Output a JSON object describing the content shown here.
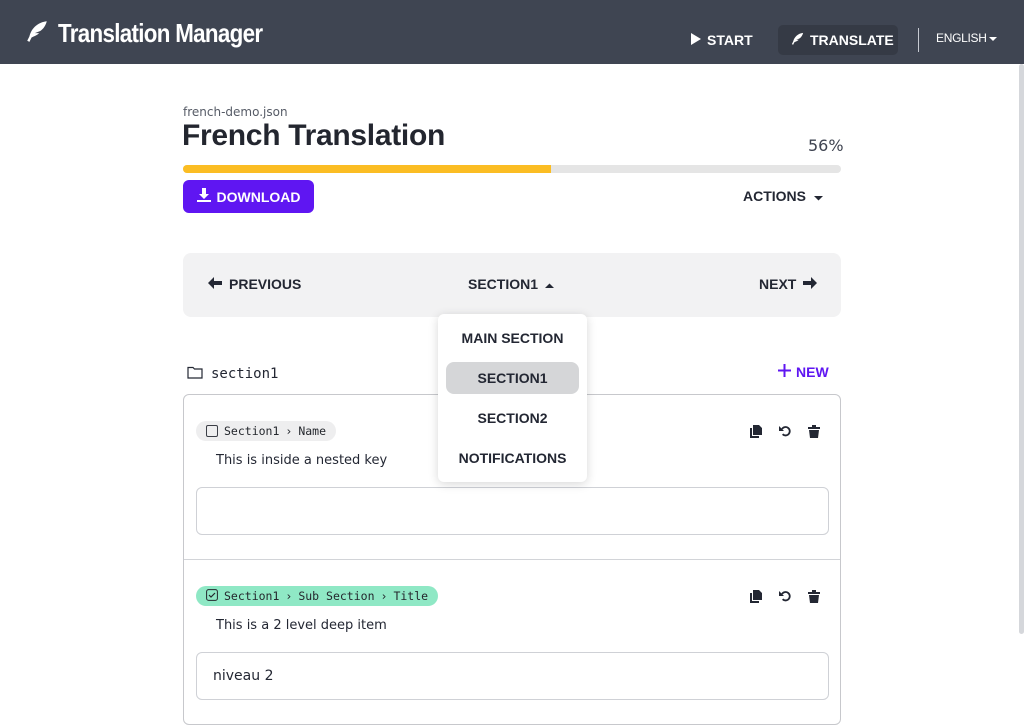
{
  "app": {
    "title": "Translation Manager",
    "nav": {
      "start": "START",
      "translate": "TRANSLATE"
    },
    "language": "ENGLISH"
  },
  "document": {
    "filename": "french-demo.json",
    "title": "French Translation",
    "progress_label": "56%",
    "progress_fraction": 0.56,
    "download_label": "DOWNLOAD",
    "actions_label": "ACTIONS"
  },
  "pager": {
    "previous": "PREVIOUS",
    "current": "SECTION1",
    "next": "NEXT",
    "menu": [
      "MAIN SECTION",
      "SECTION1",
      "SECTION2",
      "NOTIFICATIONS"
    ],
    "selected_index": 1
  },
  "section": {
    "name": "section1",
    "new_label": "NEW",
    "items": [
      {
        "path": [
          "Section1",
          "Name"
        ],
        "checked": false,
        "description": "This is inside a nested key",
        "value": ""
      },
      {
        "path": [
          "Section1",
          "Sub Section",
          "Title"
        ],
        "checked": true,
        "description": "This is a 2 level deep item",
        "value": "niveau 2"
      }
    ]
  },
  "colors": {
    "topbar": "#3f4552",
    "accent": "#5f16f2",
    "progress": "#fbbd23",
    "done_badge": "#8fe8c5"
  },
  "icons": {
    "brand": "feather-icon",
    "start": "play-icon",
    "translate": "feather-icon",
    "download": "download-icon",
    "previous": "arrow-left-icon",
    "next": "arrow-right-icon",
    "folder": "folder-icon",
    "copy": "copy-icon",
    "undo": "undo-icon",
    "delete": "trash-icon"
  }
}
